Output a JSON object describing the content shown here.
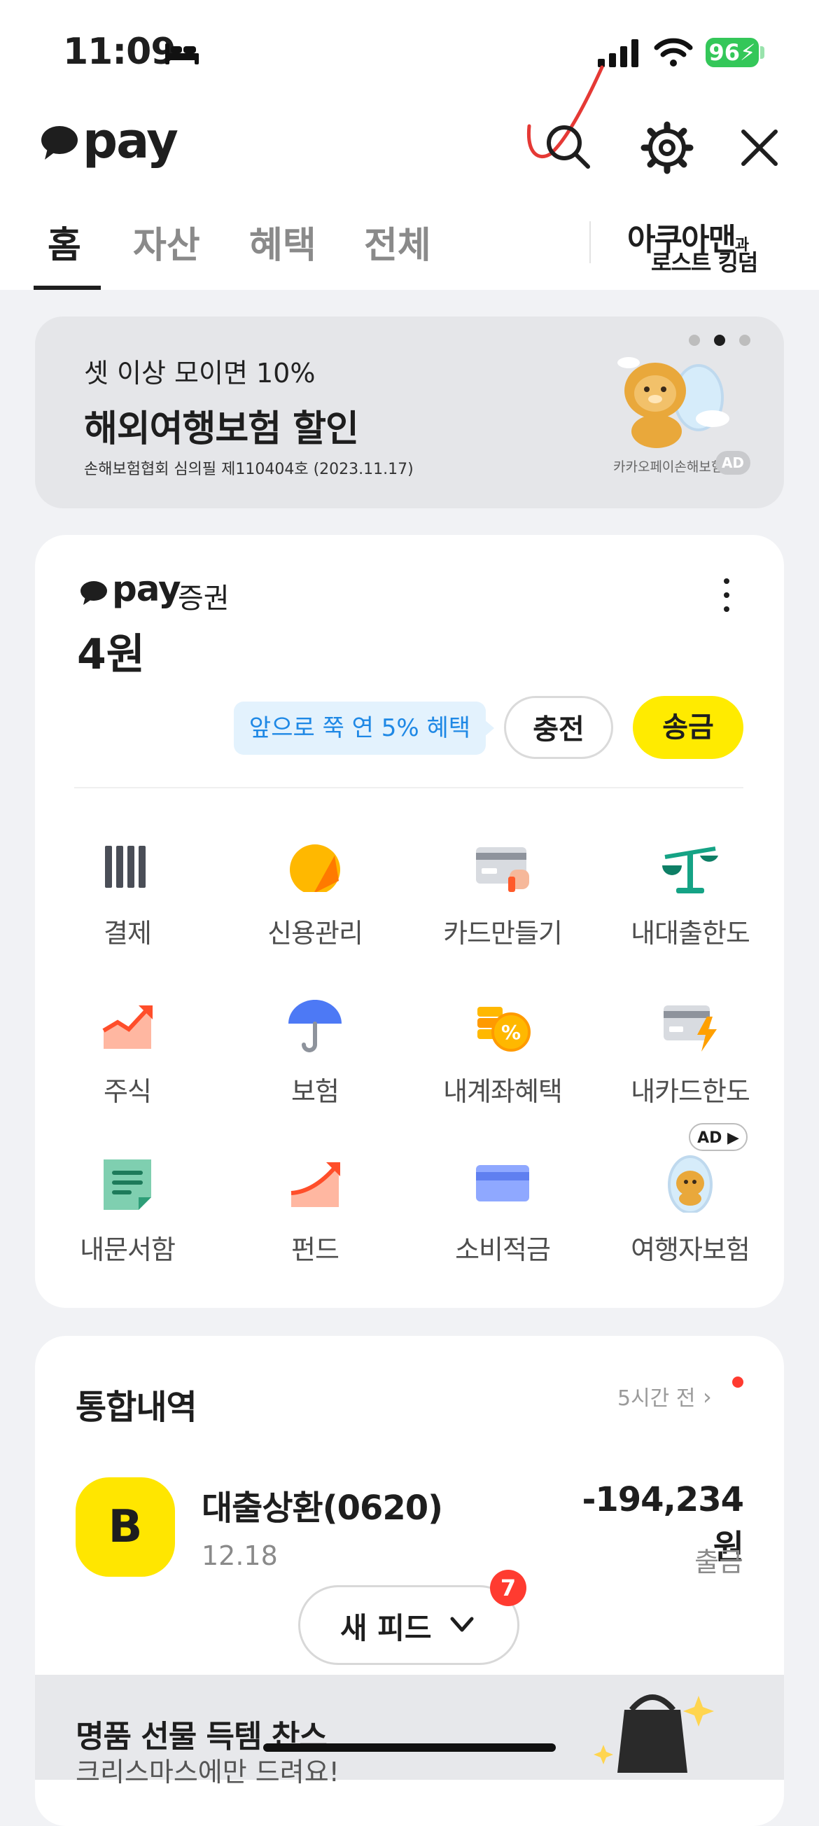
{
  "status_bar": {
    "time": "11:09",
    "battery": "96"
  },
  "header": {
    "logo_text": "pay"
  },
  "tabs": [
    {
      "label": "홈"
    },
    {
      "label": "자산"
    },
    {
      "label": "혜택"
    },
    {
      "label": "전체"
    }
  ],
  "header_promo": {
    "line1": "아쿠아맨",
    "line1_suffix": "과",
    "line2": "로스트 킹덤"
  },
  "banner": {
    "subtitle": "셋 이상 모이면 10%",
    "title": "해외여행보험 할인",
    "note": "손해보험협회 심의필 제110404호 (2023.11.17)",
    "brand": "카카오페이손해보험",
    "ad": "AD"
  },
  "securities": {
    "pay_text": "pay",
    "label": "증권",
    "balance": "4원",
    "tooltip": "앞으로 쭉 연 5% 혜택",
    "charge": "충전",
    "send": "송금"
  },
  "menu": [
    {
      "label": "결제",
      "icon": "barcode-icon"
    },
    {
      "label": "신용관리",
      "icon": "credit-gauge-icon"
    },
    {
      "label": "카드만들기",
      "icon": "card-create-icon"
    },
    {
      "label": "내대출한도",
      "icon": "scale-icon"
    },
    {
      "label": "주식",
      "icon": "stock-chart-icon"
    },
    {
      "label": "보험",
      "icon": "umbrella-icon"
    },
    {
      "label": "내계좌혜택",
      "icon": "coin-percent-icon"
    },
    {
      "label": "내카드한도",
      "icon": "card-bolt-icon"
    },
    {
      "label": "내문서함",
      "icon": "document-icon"
    },
    {
      "label": "펀드",
      "icon": "fund-chart-icon"
    },
    {
      "label": "소비적금",
      "icon": "saving-card-icon"
    },
    {
      "label": "여행자보험",
      "icon": "travel-insurance-icon"
    }
  ],
  "ad_tag": "AD ▶",
  "history": {
    "title": "통합내역",
    "time": "5시간 전",
    "tx": {
      "logo": "B",
      "name": "대출상환(0620)",
      "date": "12.18",
      "amount": "-194,234원",
      "type": "출금"
    }
  },
  "feed": {
    "label": "새 피드",
    "badge": "7"
  },
  "promo": {
    "title": "명품 선물 득템 찬스",
    "subtitle": "크리스마스에만 드려요!"
  },
  "colors": {
    "brand_yellow": "#FFEB00",
    "tooltip_blue": "#1E88E5",
    "badge_red": "#FF3B30"
  }
}
